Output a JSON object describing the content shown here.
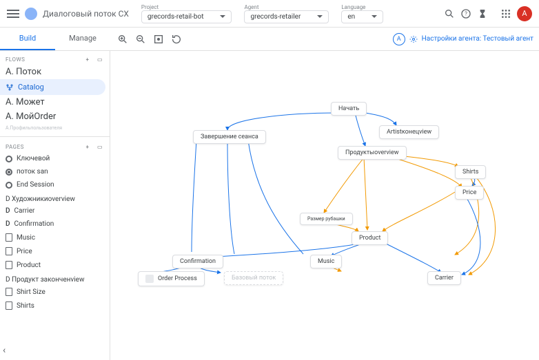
{
  "header": {
    "product": "Диалоговый поток CX",
    "project_lbl": "Project",
    "project_val": "grecords-retail-bot",
    "agent_lbl": "Agent",
    "agent_val": "grecords-retailer",
    "language_lbl": "Language",
    "language_val": "en",
    "avatar_initial": "A"
  },
  "tabs": {
    "build": "Build",
    "manage": "Manage"
  },
  "agent_settings": {
    "initial": "А",
    "label": "Настройки агента: Тестовый агент"
  },
  "sidebar": {
    "flows_hdr": "FLOWS",
    "flows": [
      {
        "label": "А. Поток"
      },
      {
        "label": "Catalog",
        "active": true
      },
      {
        "label": "А. Может"
      },
      {
        "label": "А. МойOrder"
      }
    ],
    "flows_footer": "А.Профильпользователя",
    "pages_hdr": "PAGES",
    "start_pages": [
      {
        "label": "Ключевой"
      },
      {
        "label": "поток san",
        "filled": true
      },
      {
        "label": "End Session"
      }
    ],
    "group_a": {
      "title": "D Художникиoverview",
      "items": [
        "Carrier",
        "Confirmation",
        "Music",
        "Price",
        "Product"
      ]
    },
    "group_b": {
      "title": "D Продукт законченview",
      "items": [
        "Shirt Size",
        "Shirts"
      ]
    }
  },
  "nodes": {
    "start": "Начать",
    "end_session": "Завершение сеанса",
    "artist_ov": "Artistконецview",
    "product_ov": "Продуктыoverview",
    "shirts": "Shirts",
    "price": "Price",
    "size_shirt": "Размер рубашки",
    "product": "Product",
    "confirmation": "Confirmation",
    "music": "Music",
    "order_process": "Order Process",
    "base_flow": "Базовый поток",
    "carrier": "Carrier"
  }
}
